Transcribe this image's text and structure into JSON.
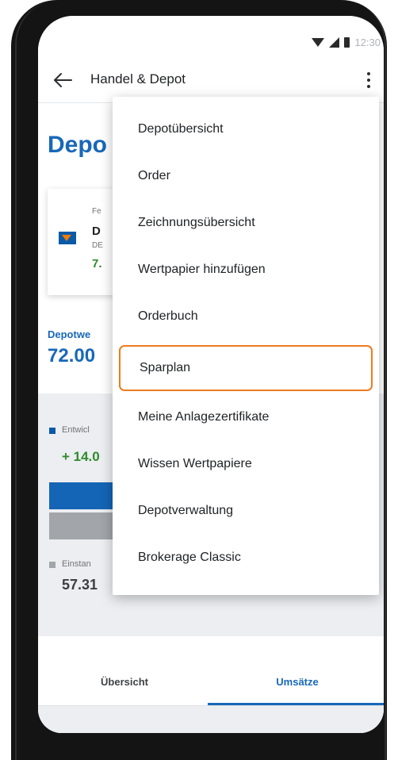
{
  "status_bar": {
    "time": "12:30"
  },
  "app_bar": {
    "title": "Handel & Depot"
  },
  "background": {
    "page_title": "Depo",
    "card": {
      "line1": "Fe",
      "line2": "D",
      "line3": "DE",
      "line4": "7."
    },
    "depot_label": "Depotwe",
    "depot_value": "72.00",
    "legend_development": "Entwicl",
    "development_value": "+ 14.0",
    "legend_einstand": "Einstan",
    "einstand_value": "57.31",
    "colors": {
      "brand_blue": "#1868b8",
      "positive_green": "#2e8b2e",
      "bar_gray": "#a2a5a9"
    }
  },
  "menu": {
    "items": [
      {
        "label": "Depotübersicht"
      },
      {
        "label": "Order"
      },
      {
        "label": "Zeichnungsübersicht"
      },
      {
        "label": "Wertpapier hinzufügen"
      },
      {
        "label": "Orderbuch"
      },
      {
        "label": "Sparplan",
        "highlighted": true
      },
      {
        "label": "Meine Anlagezertifikate"
      },
      {
        "label": "Wissen Wertpapiere"
      },
      {
        "label": "Depotverwaltung"
      },
      {
        "label": "Brokerage Classic"
      }
    ],
    "highlight_color": "#ee7b1f"
  },
  "tabs": [
    {
      "label": "Übersicht",
      "active": false
    },
    {
      "label": "Umsätze",
      "active": true
    }
  ],
  "icons": {
    "back": "arrow-left-icon",
    "more": "more-vertical-icon",
    "wifi": "wifi-icon",
    "signal": "signal-icon",
    "battery": "battery-icon",
    "logo": "vr-bank-logo-icon"
  }
}
